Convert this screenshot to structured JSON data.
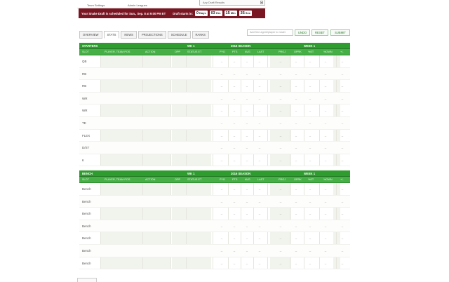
{
  "top": {
    "link_left": "Team Settings",
    "link_right": "Admin Leagues",
    "input_text": "Any Draft Results"
  },
  "banner": {
    "message": "Your Snake Draft is scheduled for Sun., Sep. 8 at 9:00 PM ET",
    "starts_label": "Draft starts in:",
    "days_value": "0",
    "days_unit": "Days",
    "hours_value": "03",
    "hours_unit": "Hrs",
    "minutes_value": "15",
    "minutes_unit": "Min",
    "seconds_value": "35",
    "seconds_unit": "Sec"
  },
  "tabs": [
    "OVERVIEW",
    "STATS",
    "NEWS",
    "PROJECTIONS",
    "SCHEDULE",
    "RANKS"
  ],
  "active_tab": "STATS",
  "search_placeholder": "Add free agent/player to roster",
  "buttons": {
    "undo": "UNDO",
    "reset": "RESET",
    "submit": "SUBMIT"
  },
  "starters": {
    "title": "STARTERS",
    "week_col": "WK 1",
    "season_col": "2016 SEASON",
    "week_right": "WEEK 1",
    "headers": [
      "SLOT",
      "PLAYER, TEAM POS",
      "ACTION",
      "OPP",
      "STATUS ET",
      "PYD",
      "PTS",
      "AVG",
      "LAST",
      "PROJ",
      "OPRK",
      "%ST",
      "%OWN",
      "+/-"
    ],
    "slots": [
      "QB",
      "RB",
      "RB",
      "WR",
      "WR",
      "TE",
      "FLEX",
      "D/ST",
      "K"
    ]
  },
  "bench": {
    "title": "BENCH",
    "week_col": "WK 1",
    "season_col": "2016 SEASON",
    "week_right": "WEEK 1",
    "headers": [
      "SLOT",
      "PLAYER, TEAM POS",
      "ACTION",
      "OPP",
      "STATUS ET",
      "PYD",
      "PTS",
      "AVG",
      "LAST",
      "PROJ",
      "OPRK",
      "%ST",
      "%OWN",
      "+/-"
    ],
    "slots": [
      "Bench",
      "Bench",
      "Bench",
      "Bench",
      "Bench",
      "Bench",
      "Bench"
    ]
  },
  "empty_value": "--",
  "colors": {
    "banner": "#7a1522",
    "header_dark": "#2f9c2f",
    "header_light": "#46b046"
  }
}
